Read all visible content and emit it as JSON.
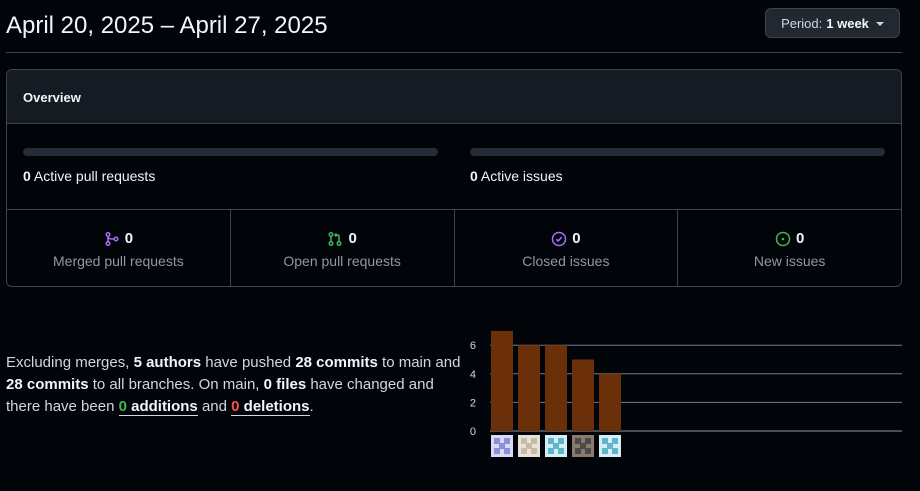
{
  "header": {
    "title": "April 20, 2025 – April 27, 2025",
    "period_label": "Period:",
    "period_value": "1 week"
  },
  "overview": {
    "title": "Overview",
    "active_prs": {
      "count": "0",
      "label": "Active pull requests",
      "progress": 0
    },
    "active_issues": {
      "count": "0",
      "label": "Active issues",
      "progress": 0
    },
    "stats": [
      {
        "icon": "merge-icon",
        "count": "0",
        "label": "Merged pull requests",
        "color": "#a371f7"
      },
      {
        "icon": "open-pr-icon",
        "count": "0",
        "label": "Open pull requests",
        "color": "#3fb950"
      },
      {
        "icon": "closed-issue-icon",
        "count": "0",
        "label": "Closed issues",
        "color": "#a371f7"
      },
      {
        "icon": "new-issue-icon",
        "count": "0",
        "label": "New issues",
        "color": "#3fb950"
      }
    ]
  },
  "summary": {
    "t1": "Excluding merges, ",
    "authors": "5 authors",
    "t2": " have pushed ",
    "commits_main": "28 commits",
    "t3": " to main and ",
    "commits_all": "28 commits",
    "t4": " to all branches. On main, ",
    "files": "0 files",
    "t5": " have changed and there have been ",
    "additions_n": "0",
    "additions_w": " additions",
    "t6": " and ",
    "deletions_n": "0",
    "deletions_w": " deletions",
    "t7": "."
  },
  "chart_data": {
    "type": "bar",
    "categories": [
      "author-1",
      "author-2",
      "author-3",
      "author-4",
      "author-5"
    ],
    "values": [
      7,
      6,
      6,
      5,
      4
    ],
    "yticks": [
      0,
      2,
      4,
      6
    ],
    "ylim": [
      0,
      7
    ],
    "bar_color": "#6b2f0a",
    "title": "",
    "xlabel": "",
    "ylabel": ""
  }
}
